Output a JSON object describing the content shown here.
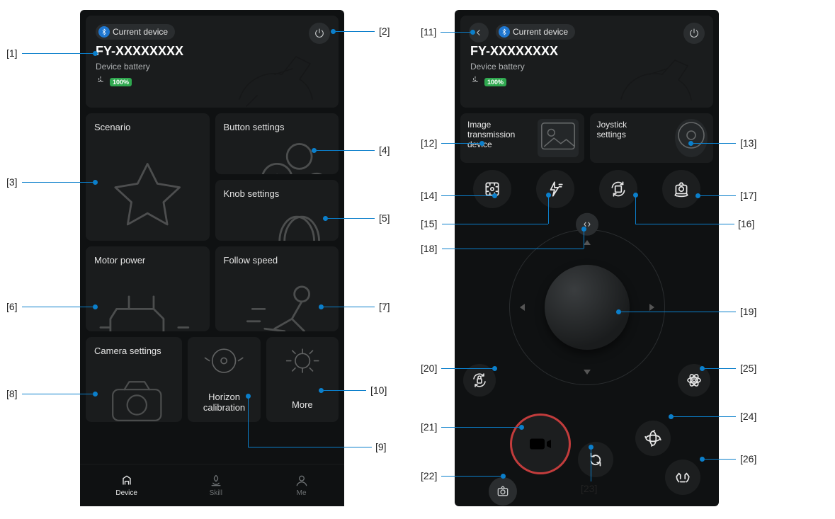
{
  "labels": {
    "current_device_pill": "Current device",
    "device_name": "FY-XXXXXXXX",
    "device_battery_label": "Device battery",
    "battery_value": "100%"
  },
  "left_screen": {
    "tiles": {
      "scenario": "Scenario",
      "button_settings": "Button settings",
      "knob_settings": "Knob settings",
      "motor_power": "Motor power",
      "follow_speed": "Follow speed",
      "camera_settings": "Camera settings",
      "horizon_calibration": "Horizon calibration",
      "more": "More"
    },
    "nav": {
      "device": "Device",
      "skill": "Skill",
      "me": "Me"
    }
  },
  "right_screen": {
    "tiles": {
      "image_transmission": "Image transmission device",
      "joystick_settings": "Joystick settings"
    }
  },
  "callouts": {
    "1": "[1]",
    "2": "[2]",
    "3": "[3]",
    "4": "[4]",
    "5": "[5]",
    "6": "[6]",
    "7": "[7]",
    "8": "[8]",
    "9": "[9]",
    "10": "[10]",
    "11": "[11]",
    "12": "[12]",
    "13": "[13]",
    "14": "[14]",
    "15": "[15]",
    "16": "[16]",
    "17": "[17]",
    "18": "[18]",
    "19": "[19]",
    "20": "[20]",
    "21": "[21]",
    "22": "[22]",
    "23": "[23]",
    "24": "[24]",
    "25": "[25]",
    "26": "[26]"
  }
}
